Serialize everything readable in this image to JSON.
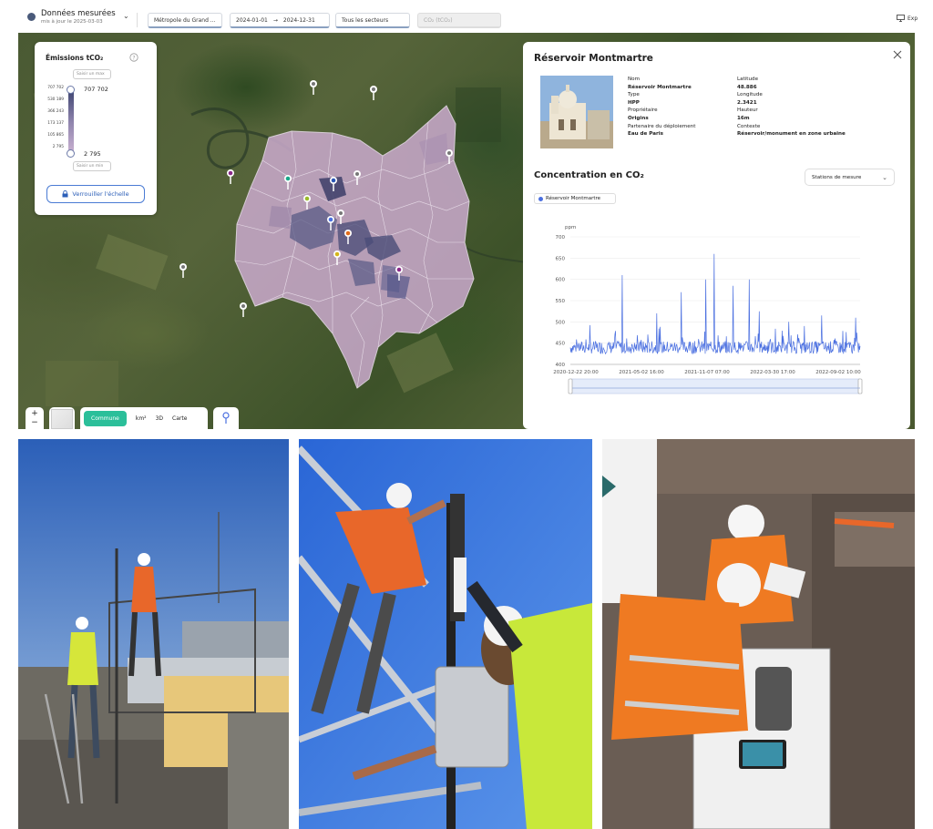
{
  "header": {
    "app_title": "Données mesurées",
    "app_subtitle": "mis à jour le 2025-03-03",
    "region_select": "Métropole du Grand ...",
    "date_start": "2024-01-01",
    "date_arrow": "→",
    "date_end": "2024-12-31",
    "sector_select": "Tous les secteurs",
    "gas_select": "CO₂ (tCO₂)",
    "exit_label": "Exp"
  },
  "legend": {
    "title": "Émissions tCO₂",
    "help_icon": "help-circle-icon",
    "max_placeholder": "Saisir un max",
    "max_value": "707 702",
    "min_value": "2 795",
    "min_placeholder": "Saisir un min",
    "scale_ticks": [
      "707 702",
      "530 189",
      "366 243",
      "173 137",
      "105 865",
      "2 795"
    ],
    "lock_label": "Verrouiller l'échelle",
    "lock_icon": "lock-icon"
  },
  "map_controls": {
    "zoom_in": "+",
    "zoom_out": "−",
    "mode_tabs": [
      "Commune",
      "km²",
      "3D",
      "Carte"
    ],
    "active_tab": "Commune"
  },
  "station_panel": {
    "title": "Réservoir Montmartre",
    "close_icon": "close-icon",
    "fields_left": [
      {
        "label": "Nom",
        "value": "Réservoir Montmartre"
      },
      {
        "label": "Type",
        "value": "HPP"
      },
      {
        "label": "Propriétaire",
        "value": "Origins"
      },
      {
        "label": "Partenaire du déploiement",
        "value": "Eau de Paris"
      }
    ],
    "fields_right": [
      {
        "label": "Latitude",
        "value": "48.886"
      },
      {
        "label": "Longitude",
        "value": "2.3421"
      },
      {
        "label": "Hauteur",
        "value": "16m"
      },
      {
        "label": "Contexte",
        "value": "Réservoir/monument en zone urbaine"
      }
    ],
    "concentration_title": "Concentration en CO₂",
    "stations_select": "Stations de mesure",
    "series_chip": "Réservoir Montmartre"
  },
  "chart_data": {
    "type": "line",
    "ylabel": "ppm",
    "ylim": [
      400,
      700
    ],
    "y_ticks": [
      400,
      450,
      500,
      550,
      600,
      650,
      700
    ],
    "x_ticks": [
      "2020-12-22 20:00",
      "2021-05-02 16:00",
      "2021-11-07 07:00",
      "2022-03-30 17:00",
      "2022-09-02 10:00"
    ],
    "series": [
      {
        "name": "Réservoir Montmartre",
        "color": "#4a6fe0",
        "peaks": [
          {
            "x": "2021-04-21",
            "y": 610
          },
          {
            "x": "2021-07-10",
            "y": 520
          },
          {
            "x": "2021-09-05",
            "y": 570
          },
          {
            "x": "2021-11-01",
            "y": 600
          },
          {
            "x": "2021-11-20",
            "y": 660
          },
          {
            "x": "2022-01-03",
            "y": 585
          },
          {
            "x": "2022-02-10",
            "y": 600
          },
          {
            "x": "2022-03-05",
            "y": 525
          },
          {
            "x": "2022-05-12",
            "y": 500
          },
          {
            "x": "2022-07-28",
            "y": 515
          },
          {
            "x": "2022-10-15",
            "y": 510
          }
        ],
        "baseline": 440
      }
    ],
    "grid": true
  },
  "colors": {
    "accent": "#2bbf9a",
    "brand_blue": "#4a6fe0",
    "region_fill": "#c9a9c9",
    "region_dark": "#3d3f6a"
  },
  "photos": [
    {
      "name": "photo-rooftop-technicians",
      "icon": "photo-icon"
    },
    {
      "name": "photo-mast-installation",
      "icon": "photo-icon"
    },
    {
      "name": "photo-analyzer-setup",
      "icon": "photo-icon"
    }
  ]
}
